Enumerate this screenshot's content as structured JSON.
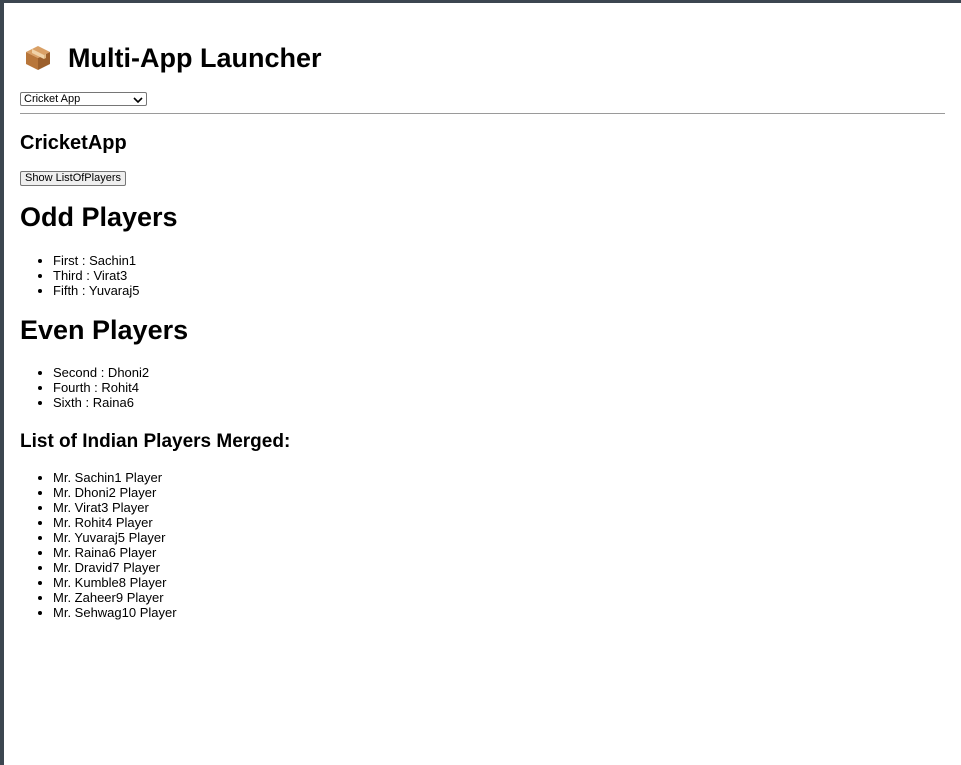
{
  "header": {
    "icon": "package-icon",
    "title": "Multi-App Launcher"
  },
  "app_select": {
    "selected": "Cricket App"
  },
  "cricket_app": {
    "title": "CricketApp",
    "show_button_label": "Show ListOfPlayers",
    "odd_heading": "Odd Players",
    "odd_players": [
      "First : Sachin1",
      "Third : Virat3",
      "Fifth : Yuvaraj5"
    ],
    "even_heading": "Even Players",
    "even_players": [
      "Second : Dhoni2",
      "Fourth : Rohit4",
      "Sixth : Raina6"
    ],
    "merged_heading": "List of Indian Players Merged:",
    "merged_players": [
      "Mr. Sachin1 Player",
      "Mr. Dhoni2 Player",
      "Mr. Virat3 Player",
      "Mr. Rohit4 Player",
      "Mr. Yuvaraj5 Player",
      "Mr. Raina6 Player",
      "Mr. Dravid7 Player",
      "Mr. Kumble8 Player",
      "Mr. Zaheer9 Player",
      "Mr. Sehwag10 Player"
    ]
  }
}
